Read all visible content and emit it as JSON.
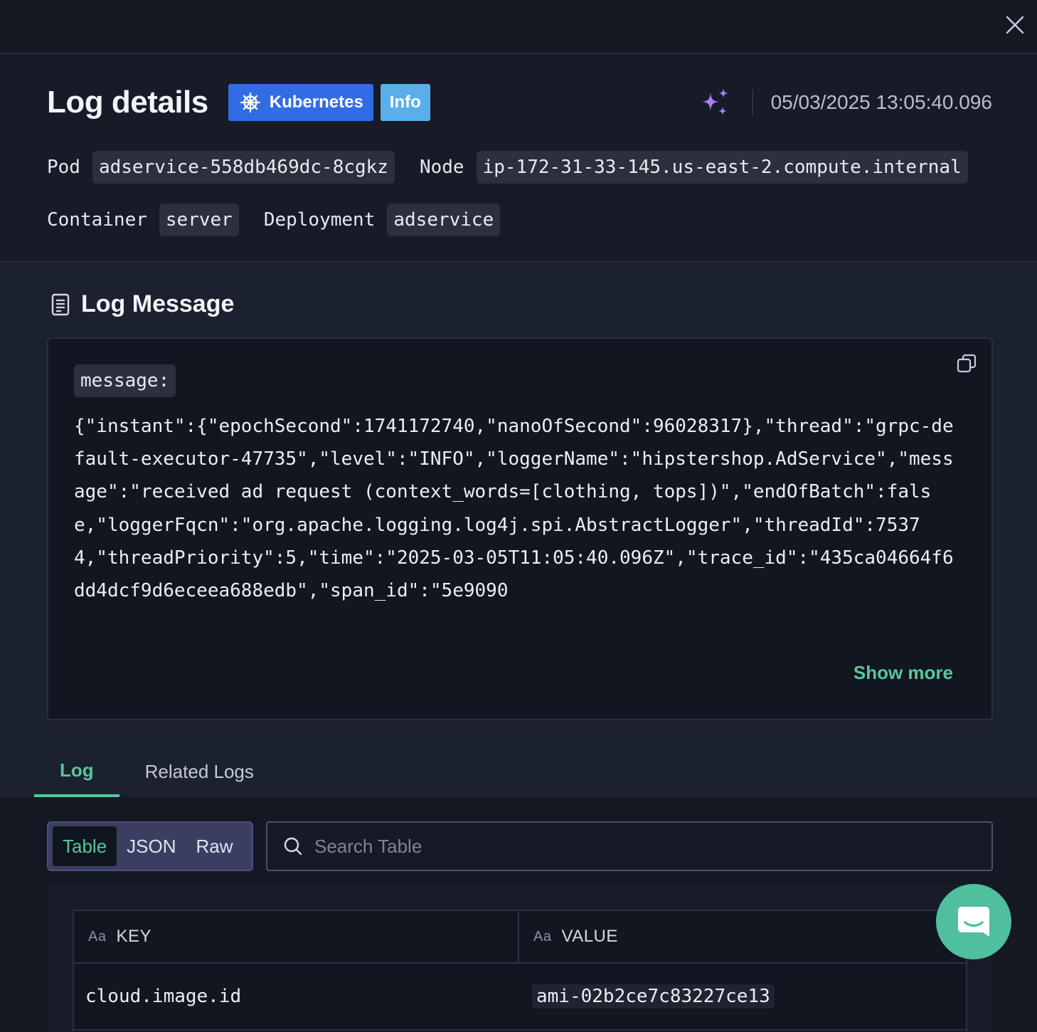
{
  "header": {
    "title": "Log details",
    "badges": {
      "platform": "Kubernetes",
      "level": "Info"
    },
    "timestamp": "05/03/2025 13:05:40.096",
    "meta": {
      "pod_label": "Pod",
      "pod_value": "adservice-558db469dc-8cgkz",
      "node_label": "Node",
      "node_value": "ip-172-31-33-145.us-east-2.compute.internal",
      "container_label": "Container",
      "container_value": "server",
      "deployment_label": "Deployment",
      "deployment_value": "adservice"
    }
  },
  "log_message": {
    "section_title": "Log Message",
    "key": "message:",
    "text": "{\"instant\":{\"epochSecond\":1741172740,\"nanoOfSecond\":96028317},\"thread\":\"grpc-default-executor-47735\",\"level\":\"INFO\",\"loggerName\":\"hipstershop.AdService\",\"message\":\"received ad request (context_words=[clothing, tops])\",\"endOfBatch\":false,\"loggerFqcn\":\"org.apache.logging.log4j.spi.AbstractLogger\",\"threadId\":75374,\"threadPriority\":5,\"time\":\"2025-03-05T11:05:40.096Z\",\"trace_id\":\"435ca04664f6dd4dcf9d6eceea688edb\",\"span_id\":\"5e9090",
    "show_more": "Show more"
  },
  "tabs": [
    "Log",
    "Related Logs"
  ],
  "view_modes": [
    "Table",
    "JSON",
    "Raw"
  ],
  "search": {
    "placeholder": "Search Table"
  },
  "table": {
    "columns": [
      "KEY",
      "VALUE"
    ],
    "column_type_glyph": "Aa",
    "rows": [
      {
        "key": "cloud.image.id",
        "value": "ami-02b2ce7c83227ce13"
      }
    ]
  },
  "colors": {
    "accent_green": "#58c79a",
    "kubernetes_blue": "#326ce5",
    "info_blue": "#5aaee9",
    "sparkle_purple": "#a77ff0",
    "chat_fab": "#4fbf9d"
  },
  "icons": [
    "close-icon",
    "kubernetes-icon",
    "sparkle-icon",
    "document-icon",
    "copy-icon",
    "search-icon",
    "chat-icon"
  ]
}
